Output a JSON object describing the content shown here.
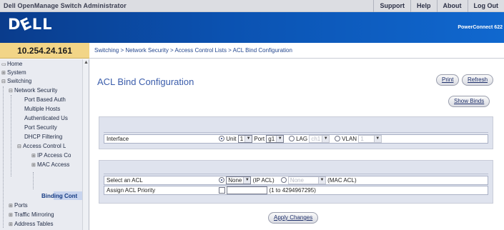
{
  "topbar": {
    "app_title": "Dell OpenManage Switch Administrator",
    "links": [
      "Support",
      "Help",
      "About",
      "Log Out"
    ]
  },
  "brand": {
    "logo": "DÉLL",
    "model": "PowerConnect 622"
  },
  "ip_address": "10.254.24.161",
  "breadcrumb": "Switching > Network Security > Access Control Lists > ACL Bind Configuration",
  "sidebar": {
    "items": [
      {
        "label": "Home",
        "expander": "▭",
        "indent": 0
      },
      {
        "label": "System",
        "expander": "⊞",
        "indent": 0
      },
      {
        "label": "Switching",
        "expander": "⊟",
        "indent": 0
      },
      {
        "label": "Network Security",
        "expander": "⊟",
        "indent": 1
      },
      {
        "label": "Port Based Auth",
        "expander": "",
        "indent": 2
      },
      {
        "label": "Multiple Hosts",
        "expander": "",
        "indent": 2
      },
      {
        "label": "Authenticated Us",
        "expander": "",
        "indent": 2
      },
      {
        "label": "Port Security",
        "expander": "",
        "indent": 2
      },
      {
        "label": "DHCP Filtering",
        "expander": "",
        "indent": 2
      },
      {
        "label": "Access Control L",
        "expander": "⊟",
        "indent": 2
      },
      {
        "label": "IP Access Co",
        "expander": "⊞",
        "indent": 3
      },
      {
        "label": "MAC Access",
        "expander": "⊞",
        "indent": 3
      },
      {
        "label": "Binding Cont",
        "expander": "",
        "indent": 4,
        "selected": true
      },
      {
        "label": "Ports",
        "expander": "⊞",
        "indent": 1
      },
      {
        "label": "Traffic Mirroring",
        "expander": "⊞",
        "indent": 1
      },
      {
        "label": "Address Tables",
        "expander": "⊞",
        "indent": 1
      }
    ]
  },
  "main": {
    "title": "ACL Bind Configuration",
    "buttons": {
      "print": "Print",
      "refresh": "Refresh",
      "show_binds": "Show Binds",
      "apply": "Apply Changes"
    },
    "interface": {
      "label": "Interface",
      "unit_label": "Unit",
      "unit_value": "1",
      "port_label": "Port",
      "port_value": "g1",
      "lag_label": "LAG",
      "lag_value": "ch1",
      "vlan_label": "VLAN",
      "vlan_value": "1",
      "selected": "unit"
    },
    "acl": {
      "label": "Select an ACL",
      "ip_value": "None",
      "ip_suffix": "(IP ACL)",
      "mac_value": "None",
      "mac_suffix": "(MAC ACL)",
      "selected": "ip"
    },
    "priority": {
      "label": "Assign ACL Priority",
      "value": "",
      "range": "(1 to 4294967295)"
    }
  },
  "colors": {
    "brand_blue": "#0b52b1",
    "ip_bar": "#f2d587",
    "title_blue": "#3b5dab",
    "panel_bg": "#dfe3ee"
  }
}
